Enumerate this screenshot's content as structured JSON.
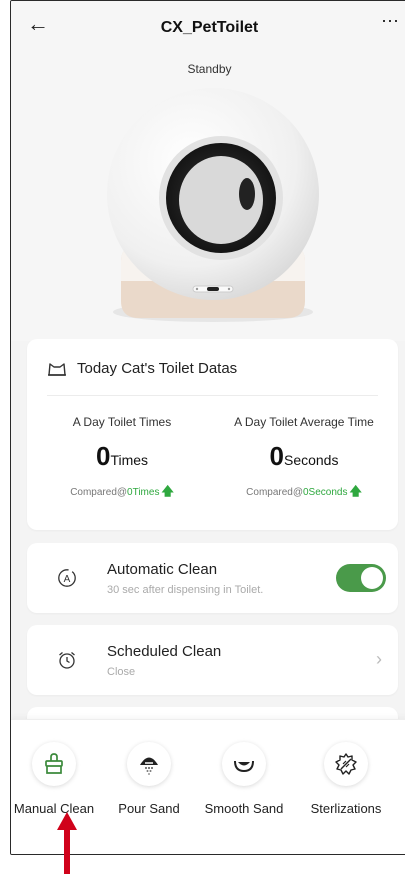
{
  "header": {
    "title": "CX_PetToilet",
    "status": "Standby",
    "back_icon": "back-arrow-icon",
    "more_icon": "more-dots-icon"
  },
  "toilet_data": {
    "title": "Today Cat's Toilet Datas",
    "left": {
      "label": "A Day Toilet Times",
      "value": "0",
      "unit": "Times",
      "compare_prefix": "Compared@",
      "compare_value": "0Times"
    },
    "right": {
      "label": "A Day Toilet Average Time",
      "value": "0",
      "unit": "Seconds",
      "compare_prefix": "Compared@",
      "compare_value": "0Seconds"
    }
  },
  "automatic_clean": {
    "title": "Automatic Clean",
    "subtitle": "30 sec after dispensing in Toilet.",
    "enabled": true
  },
  "scheduled_clean": {
    "title": "Scheduled Clean",
    "subtitle": "Close"
  },
  "actions": [
    {
      "label": "Manual Clean",
      "icon": "broom-icon"
    },
    {
      "label": "Pour Sand",
      "icon": "pour-sand-icon"
    },
    {
      "label": "Smooth Sand",
      "icon": "smooth-sand-icon"
    },
    {
      "label": "Sterlizations",
      "icon": "sterilization-icon"
    }
  ],
  "colors": {
    "accent": "#4a9a4a",
    "compare_green": "#2fa83f",
    "pointer_arrow": "#d0021b"
  }
}
